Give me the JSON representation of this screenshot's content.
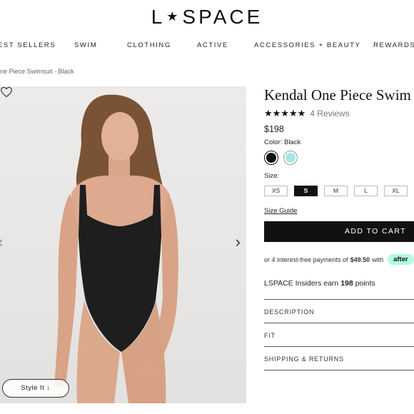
{
  "header": {
    "logo_left": "L",
    "logo_star": "★",
    "logo_right": "SPACE"
  },
  "nav": {
    "items": [
      "EST SELLERS",
      "SWIM",
      "CLOTHING",
      "ACTIVE",
      "ACCESSORIES + BEAUTY",
      "REWARDS"
    ]
  },
  "breadcrumb": "ne Piece Swimsuit - Black",
  "gallery": {
    "prev_arrow": "‹",
    "next_arrow": "›",
    "style_it_label": "Style It ↓"
  },
  "product": {
    "title": "Kendal One Piece Swim",
    "stars": "★★★★★",
    "rating": 4.5,
    "reviews": "4 Reviews",
    "price": "$198",
    "color_label": "Color: Black",
    "colors": [
      {
        "name": "Black",
        "hex": "#111111",
        "selected": true
      },
      {
        "name": "Mint",
        "hex": "#a9e6e2",
        "selected": false
      }
    ],
    "size_label": "Size:",
    "sizes": [
      "XS",
      "S",
      "M",
      "L",
      "XL"
    ],
    "selected_size": "S",
    "size_guide": "Size Guide",
    "add_to_cart": "ADD TO CART",
    "afterpay": {
      "prefix": "or 4 interest-free payments of",
      "amount": "$49.50",
      "suffix": "with",
      "badge": "after"
    },
    "insiders": {
      "prefix": "LSPACE Insiders earn",
      "points": "198",
      "suffix": "points"
    }
  },
  "accordions": [
    "DESCRIPTION",
    "FIT",
    "SHIPPING & RETURNS"
  ],
  "colors": {
    "accent": "#111111",
    "afterpay_badge": "#b2fce4",
    "page_bg": "#ffffff"
  }
}
